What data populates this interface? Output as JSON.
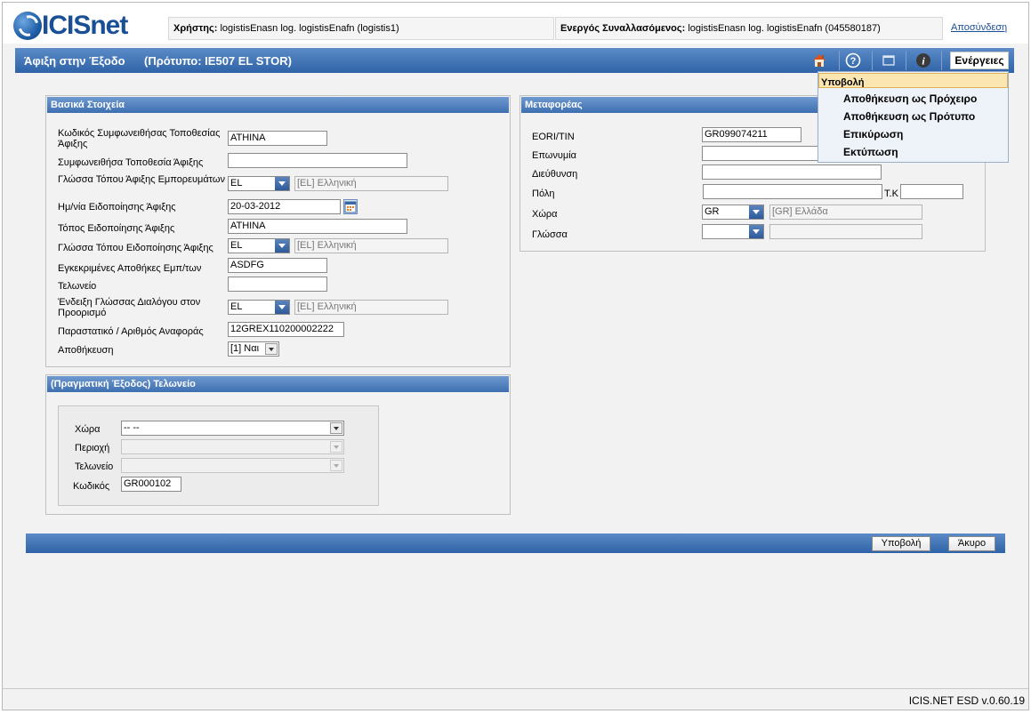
{
  "app": {
    "logo_text": "ICISnet",
    "version": "ICIS.NET ESD v.0.60.19"
  },
  "header": {
    "user_label": "Χρήστης:",
    "user_value": "logistisEnasn log. logistisEnafn (logistis1)",
    "trader_label": "Ενεργός Συναλλασόμενος:",
    "trader_value": "logistisEnasn log. logistisEnafn (045580187)",
    "logout": "Αποσύνδεση"
  },
  "titlebar": {
    "title": "Άφιξη στην Έξοδο",
    "template": "(Πρότυπο: IE507 EL STOR)",
    "actions_label": "Ενέργειες",
    "icons": [
      "home-icon",
      "help-icon",
      "window-icon",
      "info-icon"
    ]
  },
  "actions_menu": {
    "items": [
      "Υποβολή",
      "Αποθήκευση ως Πρόχειρο",
      "Αποθήκευση ως Πρότυπο",
      "Επικύρωση",
      "Εκτύπωση"
    ],
    "selected": "Υποβολή"
  },
  "basic": {
    "title": "Βασικά Στοιχεία",
    "agreed_location_code_label": "Κωδικός Συμφωνειθήσας Τοποθεσίας Άφιξης",
    "agreed_location_code": "ATHINA",
    "agreed_location_label": "Συμφωνειθήσα Τοποθεσία Άφιξης",
    "agreed_location": "",
    "goods_location_lang_label": "Γλώσσα Τόπου Άφιξης Εμπορευμάτων",
    "goods_location_lang_code": "EL",
    "goods_location_lang_desc": "[EL] Ελληνική",
    "notification_date_label": "Ημ/νία Ειδοποίησης Άφιξης",
    "notification_date": "20-03-2012",
    "notification_place_label": "Τόπος Ειδοποίησης Άφιξης",
    "notification_place": "ATHINA",
    "notification_place_lang_label": "Γλώσσα Τόπου Ειδοποίησης Άφιξης",
    "notification_place_lang_code": "EL",
    "notification_place_lang_desc": "[EL] Ελληνική",
    "warehouses_label": "Εγκεκριμένες Αποθήκες Εμπ/των",
    "warehouses": "ASDFG",
    "customs_label": "Τελωνείο",
    "customs": "",
    "dialog_lang_label": "Ένδειξη Γλώσσας Διαλόγου στον Προορισμό",
    "dialog_lang_code": "EL",
    "dialog_lang_desc": "[EL] Ελληνική",
    "reference_label": "Παραστατικό / Αριθμός Αναφοράς",
    "reference": "12GREX110200002222",
    "storage_label": "Αποθήκευση",
    "storage": "[1] Ναι"
  },
  "exit_office": {
    "title": "(Πραγματική Έξοδος) Τελωνείο",
    "country_label": "Χώρα",
    "country": "-- --",
    "region_label": "Περιοχή",
    "region": "",
    "office_label": "Τελωνείο",
    "office": "",
    "code_label": "Κωδικός",
    "code": "GR000102"
  },
  "carrier": {
    "title": "Μεταφορέας",
    "eori_label": "EORI/TIN",
    "eori": "GR099074211",
    "name_label": "Επωνυμία",
    "name": "",
    "address_label": "Διεύθυνση",
    "address": "",
    "city_label": "Πόλη",
    "city": "",
    "postcode_label": "Τ.Κ",
    "postcode": "",
    "country_label": "Χώρα",
    "country_code": "GR",
    "country_desc": "[GR] Ελλάδα",
    "language_label": "Γλώσσα",
    "language_code": "",
    "language_desc": ""
  },
  "footer": {
    "submit": "Υποβολή",
    "cancel": "Άκυρο"
  }
}
